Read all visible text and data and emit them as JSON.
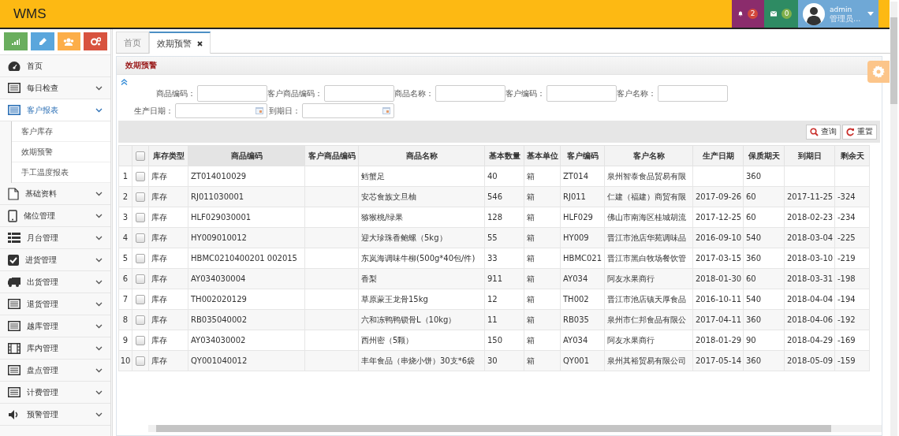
{
  "header": {
    "logo": "WMS",
    "notifications": {
      "count": "2"
    },
    "messages": {
      "count": "0"
    },
    "user": {
      "name": "admin",
      "role": "管理员..."
    }
  },
  "sidebar": {
    "items": [
      {
        "label": "首页"
      },
      {
        "label": "每日检查",
        "expanded": false
      },
      {
        "label": "客户报表",
        "expanded": true,
        "children": [
          {
            "label": "客户库存"
          },
          {
            "label": "效期预警"
          },
          {
            "label": "手工温度报表"
          }
        ]
      },
      {
        "label": "基础资料",
        "expanded": false
      },
      {
        "label": "储位管理",
        "expanded": false
      },
      {
        "label": "月台管理",
        "expanded": false
      },
      {
        "label": "进货管理",
        "expanded": false
      },
      {
        "label": "出货管理",
        "expanded": false
      },
      {
        "label": "退货管理",
        "expanded": false
      },
      {
        "label": "越库管理",
        "expanded": false
      },
      {
        "label": "库内管理",
        "expanded": false
      },
      {
        "label": "盘点管理",
        "expanded": false
      },
      {
        "label": "计费管理",
        "expanded": false
      },
      {
        "label": "预警管理",
        "expanded": false
      }
    ]
  },
  "tabs": [
    {
      "label": "首页",
      "selected": false,
      "closable": false
    },
    {
      "label": "效期预警",
      "selected": true,
      "closable": true
    }
  ],
  "panel": {
    "title": "效期预警",
    "filters": [
      {
        "label": "商品编码：",
        "kind": "text"
      },
      {
        "label": "客户商品编码：",
        "kind": "text"
      },
      {
        "label": "商品名称：",
        "kind": "text"
      },
      {
        "label": "客户编码：",
        "kind": "text"
      },
      {
        "label": "客户名称：",
        "kind": "text"
      },
      {
        "label": "生产日期：",
        "kind": "date"
      },
      {
        "label": "到期日：",
        "kind": "date"
      }
    ],
    "buttons": [
      {
        "label": "查询",
        "kind": "search"
      },
      {
        "label": "重置",
        "kind": "reset"
      }
    ],
    "table": {
      "header_checked": false,
      "columns": [
        "库存类型",
        "商品编码",
        "客户商品编码",
        "商品名称",
        "基本数量",
        "基本单位",
        "客户编码",
        "客户名称",
        "生产日期",
        "保质期天",
        "到期日",
        "剩余天"
      ],
      "rows": [
        {
          "index": "1",
          "checked": false,
          "cells": [
            "库存",
            "ZT014010029",
            "",
            "鳕蟹足",
            "40",
            "箱",
            "ZT014",
            "泉州智泰食品贸易有限",
            "",
            "360",
            "",
            ""
          ]
        },
        {
          "index": "2",
          "checked": false,
          "cells": [
            "库存",
            "RJ011030001",
            "",
            "安芯食族文旦柚",
            "546",
            "箱",
            "RJ011",
            "仁建（福建）商贸有限",
            "2017-09-26",
            "60",
            "2017-11-25",
            "-324"
          ]
        },
        {
          "index": "3",
          "checked": false,
          "cells": [
            "库存",
            "HLF029030001",
            "",
            "猕猴桃/绿果",
            "128",
            "箱",
            "HLF029",
            "佛山市南海区桂城胡流",
            "2017-12-25",
            "60",
            "2018-02-23",
            "-234"
          ]
        },
        {
          "index": "4",
          "checked": false,
          "cells": [
            "库存",
            "HY009010012",
            "",
            "迎大珍珠香鲍螺（5kg）",
            "55",
            "箱",
            "HY009",
            "晋江市池店华苑调味品",
            "2016-09-10",
            "540",
            "2018-03-04",
            "-225"
          ]
        },
        {
          "index": "5",
          "checked": false,
          "cells": [
            "库存",
            "HBMC0210400201 002015",
            "",
            "东岚海调味牛柳(500g*40包/件)",
            "33",
            "箱",
            "HBMC021",
            "晋江市黑白牧场餐饮管",
            "2017-03-15",
            "360",
            "2018-03-10",
            "-219"
          ]
        },
        {
          "index": "6",
          "checked": false,
          "cells": [
            "库存",
            "AY034030004",
            "",
            "香梨",
            "911",
            "箱",
            "AY034",
            "阿友水果商行",
            "2018-01-30",
            "60",
            "2018-03-31",
            "-198"
          ]
        },
        {
          "index": "7",
          "checked": false,
          "cells": [
            "库存",
            "TH002020129",
            "",
            "草原蒙王龙骨15kg",
            "12",
            "箱",
            "TH002",
            "晋江市池店镇天厚食品",
            "2016-10-11",
            "540",
            "2018-04-04",
            "-194"
          ]
        },
        {
          "index": "8",
          "checked": false,
          "cells": [
            "库存",
            "RB035040002",
            "",
            "六和冻鸭鸭锁骨L（10kg）",
            "11",
            "箱",
            "RB035",
            "泉州市仁邦食品有限公",
            "2017-04-11",
            "360",
            "2018-04-06",
            "-192"
          ]
        },
        {
          "index": "9",
          "checked": false,
          "cells": [
            "库存",
            "AY034030002",
            "",
            "西州密（5颗）",
            "150",
            "箱",
            "AY034",
            "阿友水果商行",
            "2018-01-29",
            "90",
            "2018-04-29",
            "-169"
          ]
        },
        {
          "index": "10",
          "checked": false,
          "cells": [
            "库存",
            "QY001040012",
            "",
            "丰年食品（串烧小饼）30支*6袋",
            "30",
            "箱",
            "QY001",
            "泉州其裕贸易有限公司",
            "2017-05-14",
            "360",
            "2018-05-09",
            "-159"
          ]
        }
      ]
    }
  }
}
